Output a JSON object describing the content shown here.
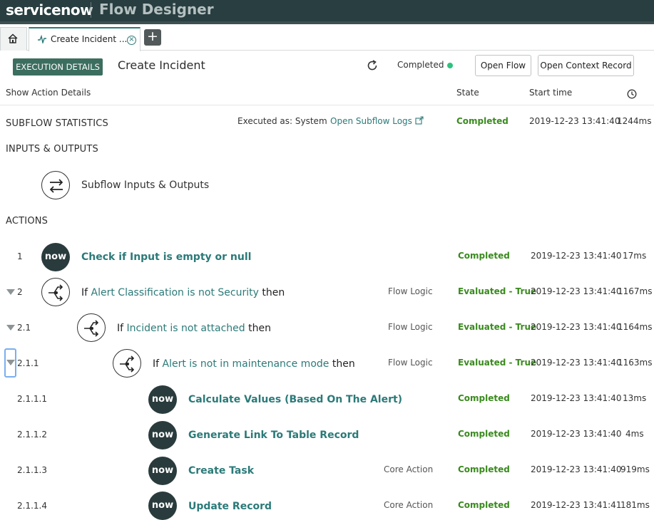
{
  "banner": {
    "logo": "servicenow",
    "app": "Flow Designer"
  },
  "tabs": {
    "active_label": "Create Incident ...",
    "close": "×",
    "add": "+"
  },
  "header": {
    "badge": "EXECUTION DETAILS",
    "title": "Create Incident",
    "status": "Completed",
    "status_color": "#2ec27e",
    "open_flow": "Open Flow",
    "open_context": "Open Context Record"
  },
  "columns": {
    "show_details": "Show Action Details",
    "state": "State",
    "start_time": "Start time",
    "duration_icon": "clock-icon"
  },
  "subflow_stats": {
    "title": "SUBFLOW STATISTICS",
    "executed_as": "Executed as: System",
    "logs_link": "Open Subflow Logs",
    "state": "Completed",
    "start": "2019-12-23 13:41:40",
    "duration": "1244ms"
  },
  "io": {
    "title": "INPUTS & OUTPUTS",
    "label": "Subflow Inputs & Outputs"
  },
  "actions_title": "ACTIONS",
  "rows": [
    {
      "num": "1",
      "icon_text": "now",
      "prefix": "",
      "name": "Check if Input is empty or null",
      "suffix": "",
      "type": "",
      "state": "Completed",
      "start": "2019-12-23 13:41:40",
      "duration": "17ms"
    },
    {
      "num": "2",
      "icon_text": "",
      "prefix": "If",
      "name": "Alert Classification is not Security",
      "suffix": "then",
      "type": "Flow Logic",
      "state": "Evaluated - True",
      "start": "2019-12-23 13:41:40",
      "duration": "1167ms"
    },
    {
      "num": "2.1",
      "icon_text": "",
      "prefix": "If",
      "name": "Incident is not attached",
      "suffix": "then",
      "type": "Flow Logic",
      "state": "Evaluated - True",
      "start": "2019-12-23 13:41:40",
      "duration": "1164ms"
    },
    {
      "num": "2.1.1",
      "icon_text": "",
      "prefix": "If",
      "name": "Alert is not in maintenance mode",
      "suffix": "then",
      "type": "Flow Logic",
      "state": "Evaluated - True",
      "start": "2019-12-23 13:41:40",
      "duration": "1163ms"
    },
    {
      "num": "2.1.1.1",
      "icon_text": "now",
      "prefix": "",
      "name": "Calculate Values (Based On The Alert)",
      "suffix": "",
      "type": "",
      "state": "Completed",
      "start": "2019-12-23 13:41:40",
      "duration": "13ms"
    },
    {
      "num": "2.1.1.2",
      "icon_text": "now",
      "prefix": "",
      "name": "Generate Link To Table Record",
      "suffix": "",
      "type": "",
      "state": "Completed",
      "start": "2019-12-23 13:41:40",
      "duration": "4ms"
    },
    {
      "num": "2.1.1.3",
      "icon_text": "now",
      "prefix": "",
      "name": "Create Task",
      "suffix": "",
      "type": "Core Action",
      "state": "Completed",
      "start": "2019-12-23 13:41:40",
      "duration": "919ms"
    },
    {
      "num": "2.1.1.4",
      "icon_text": "now",
      "prefix": "",
      "name": "Update Record",
      "suffix": "",
      "type": "Core Action",
      "state": "Completed",
      "start": "2019-12-23 13:41:41",
      "duration": "181ms"
    }
  ]
}
